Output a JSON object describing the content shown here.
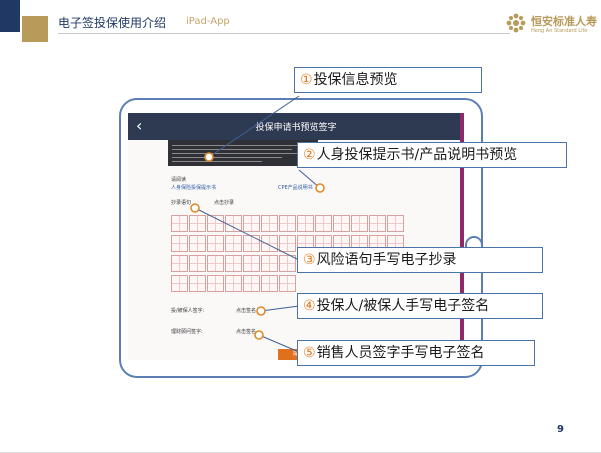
{
  "header": {
    "title": "电子签投保使用介绍",
    "subtitle": "iPad-App",
    "logo": {
      "name_cn": "恒安标准人寿",
      "name_en": "Heng An Standard Life"
    }
  },
  "ipad_screen": {
    "back_icon": "chevron-left-icon",
    "title": "投保申请书预览签字",
    "section_read": "请阅读",
    "notice_link": "人身保险投保提示书",
    "product_link": "CPE产品说明书",
    "copy_label": "抄录语句",
    "copy_hint": "点击抄录",
    "applicant_sign_label": "投/被保人签字:",
    "applicant_sign_hint": "点击签名",
    "agent_sign_label": "理财顾问签字:",
    "agent_sign_hint": "点击签名",
    "submit_button": "提交"
  },
  "callouts": [
    {
      "num": "①",
      "text": "投保信息预览"
    },
    {
      "num": "②",
      "text": "人身投保提示书/产品说明书预览"
    },
    {
      "num": "③",
      "text": "风险语句手写电子抄录"
    },
    {
      "num": "④",
      "text": "投保人/被保人手写电子签名"
    },
    {
      "num": "⑤",
      "text": "销售人员签字手写电子签名"
    }
  ],
  "page_number": "9",
  "colors": {
    "navy": "#1f3864",
    "gold": "#b89a5a",
    "callout_border": "#4a73a8",
    "number_orange": "#e07a20",
    "marker_orange": "#e08a2a"
  }
}
